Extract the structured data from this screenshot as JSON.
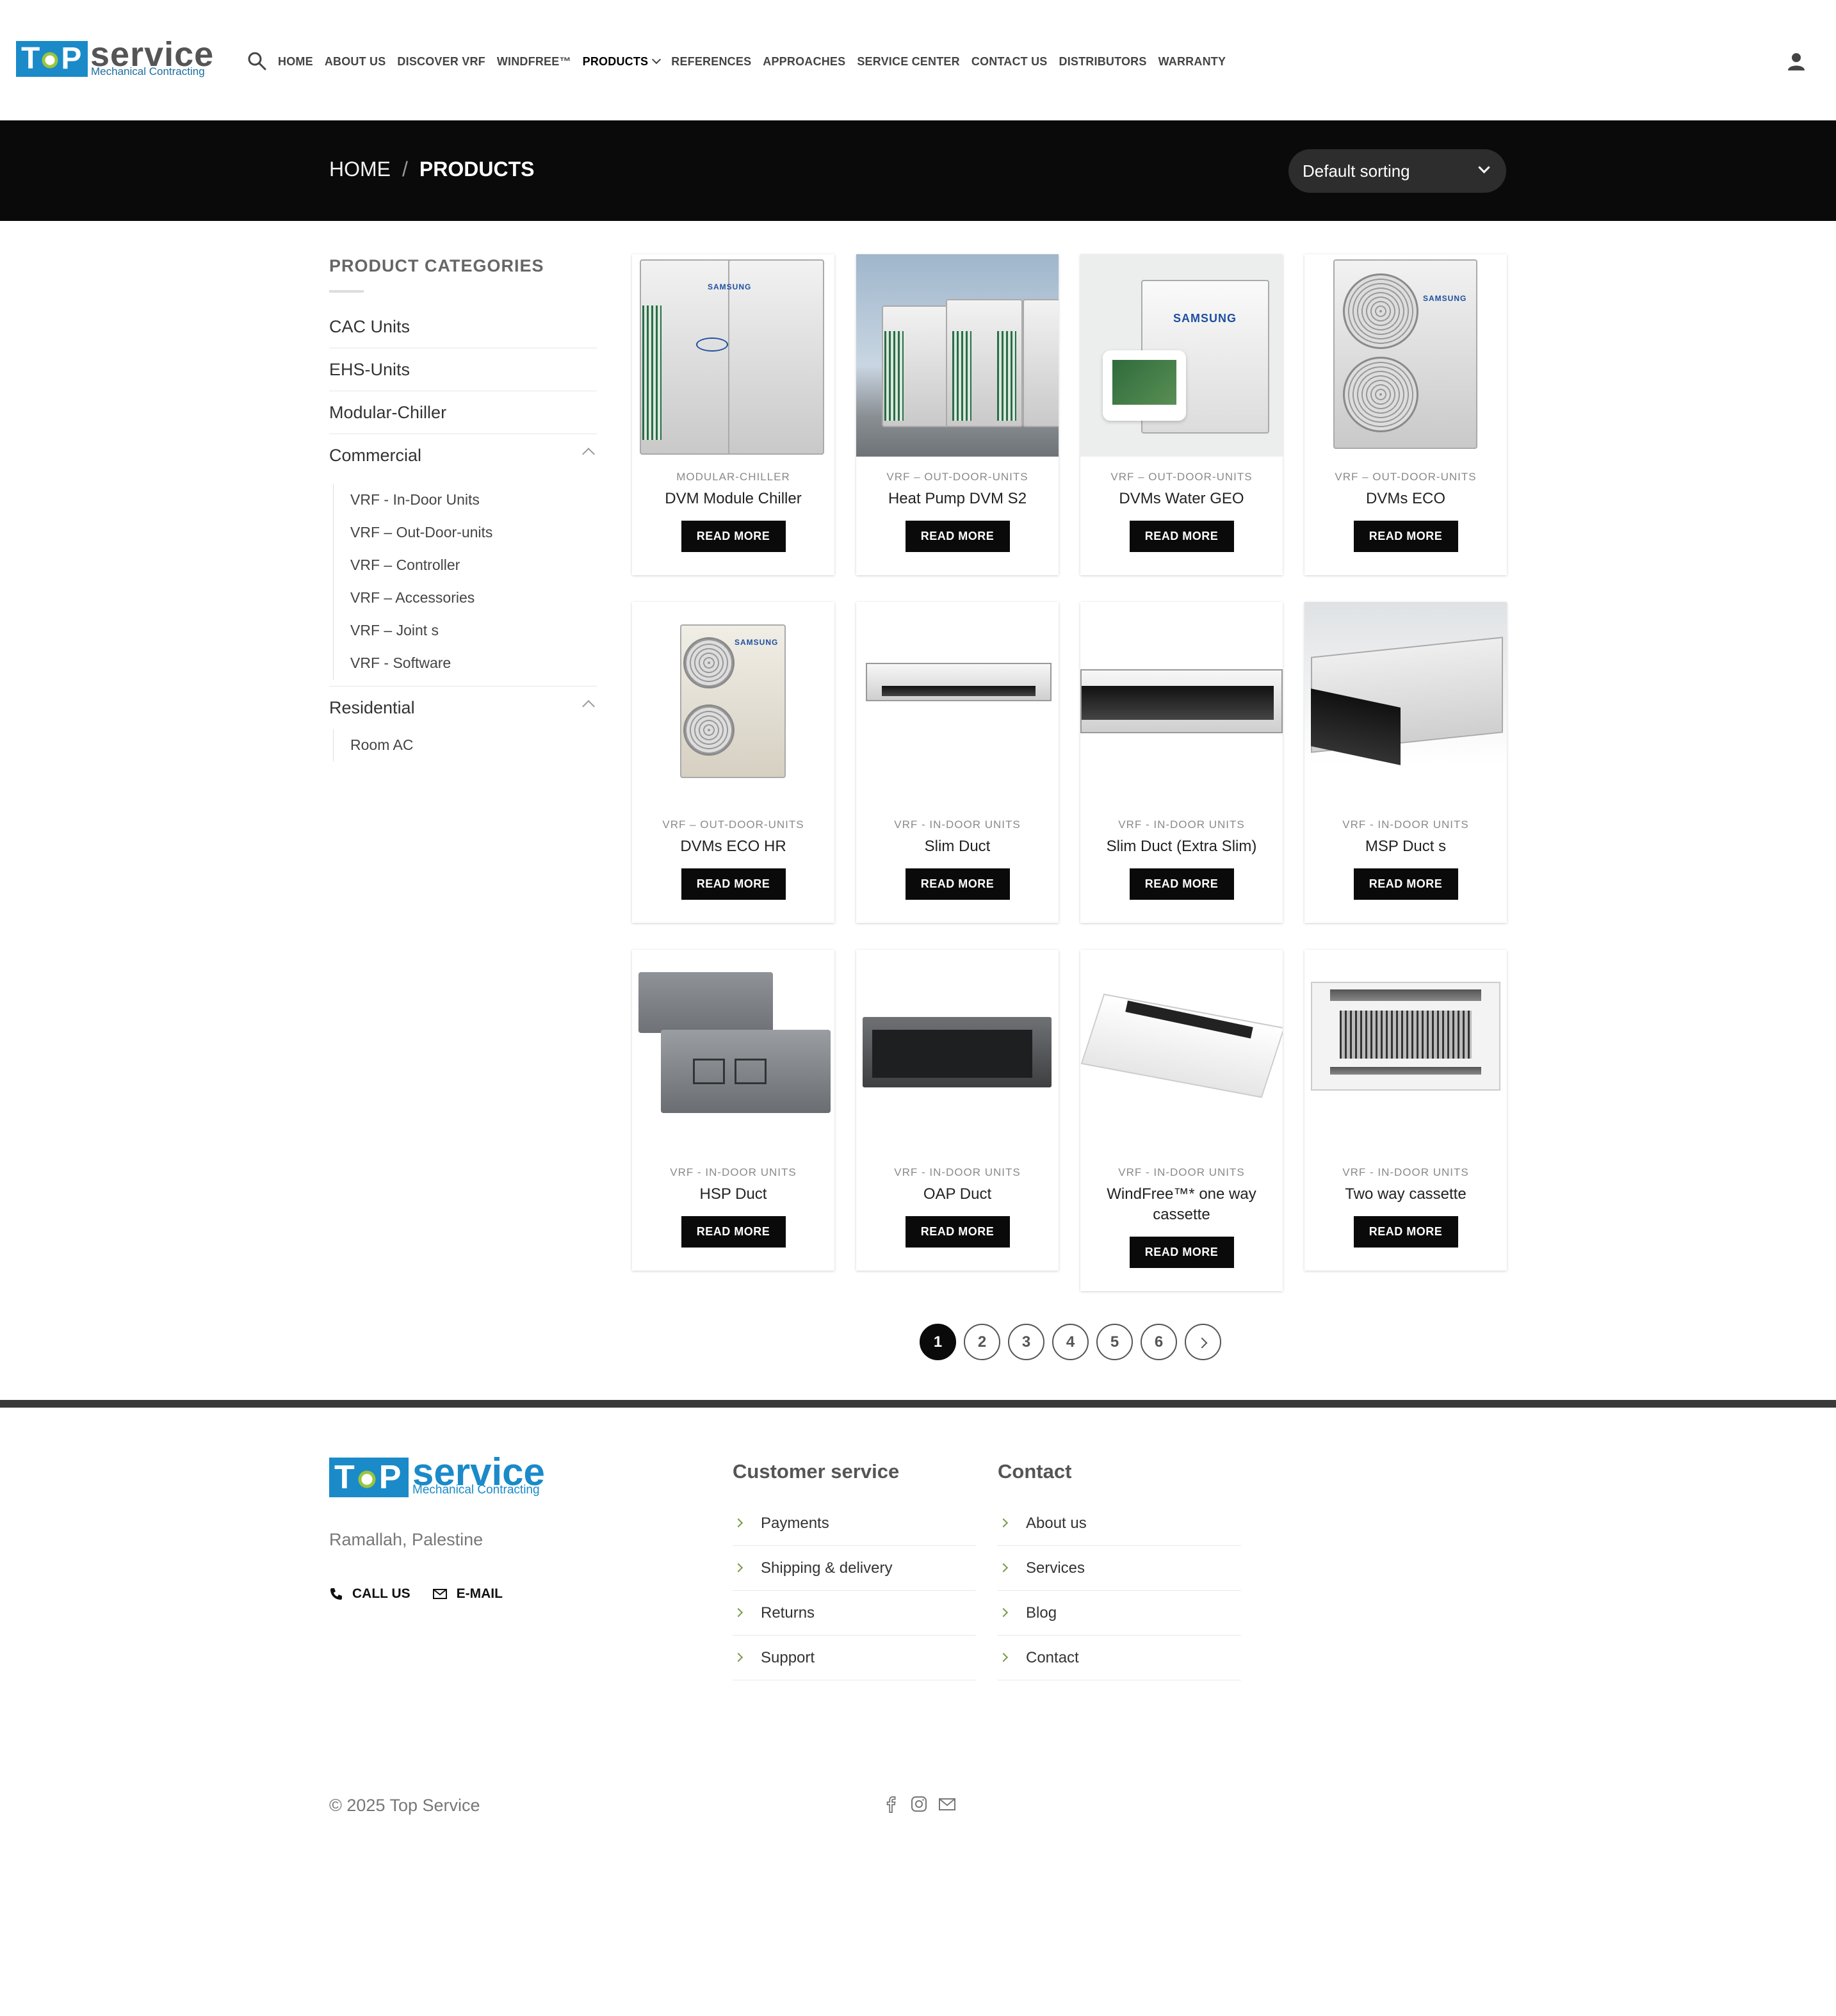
{
  "header": {
    "logo": {
      "word_a": "T",
      "word_b": "P",
      "word_service": "service",
      "tagline": "Mechanical Contracting"
    },
    "nav": [
      {
        "label": "HOME",
        "active": false
      },
      {
        "label": "ABOUT US",
        "active": false
      },
      {
        "label": "DISCOVER VRF",
        "active": false
      },
      {
        "label": "WINDFREE™",
        "active": false
      },
      {
        "label": "PRODUCTS",
        "active": true,
        "has_dropdown": true
      },
      {
        "label": "REFERENCES",
        "active": false
      },
      {
        "label": "APPROACHES",
        "active": false
      },
      {
        "label": "SERVICE CENTER",
        "active": false
      },
      {
        "label": "CONTACT US",
        "active": false
      },
      {
        "label": "DISTRIBUTORS",
        "active": false
      },
      {
        "label": "WARRANTY",
        "active": false
      }
    ],
    "icons": {
      "search": "search-icon",
      "account": "user-icon"
    }
  },
  "titlebar": {
    "breadcrumb_home": "HOME",
    "breadcrumb_sep": "/",
    "breadcrumb_current": "PRODUCTS",
    "sort_selected": "Default sorting"
  },
  "sidebar": {
    "title": "PRODUCT CATEGORIES",
    "categories": [
      {
        "label": "CAC Units"
      },
      {
        "label": "EHS-Units"
      },
      {
        "label": "Modular-Chiller"
      },
      {
        "label": "Commercial",
        "expanded": true,
        "children": [
          "VRF - In-Door Units",
          "VRF – Out-Door-units",
          "VRF – Controller",
          "VRF – Accessories",
          "VRF – Joint s",
          "VRF - Software"
        ]
      },
      {
        "label": "Residential",
        "expanded": true,
        "children": [
          "Room AC"
        ]
      }
    ]
  },
  "products": [
    {
      "category": "MODULAR-CHILLER",
      "name": "DVM Module Chiller",
      "button": "READ MORE",
      "image": "outdoor-chiller"
    },
    {
      "category": "VRF – OUT-DOOR-UNITS",
      "name": "Heat Pump DVM S2",
      "button": "READ MORE",
      "image": "rooftop-units"
    },
    {
      "category": "VRF – OUT-DOOR-UNITS",
      "name": "DVMs Water GEO",
      "button": "READ MORE",
      "image": "water-unit"
    },
    {
      "category": "VRF – OUT-DOOR-UNITS",
      "name": "DVMs ECO",
      "button": "READ MORE",
      "image": "two-fan-unit"
    },
    {
      "category": "VRF – OUT-DOOR-UNITS",
      "name": "DVMs ECO HR",
      "button": "READ MORE",
      "image": "two-fan-unit-beige"
    },
    {
      "category": "VRF - IN-DOOR UNITS",
      "name": "Slim Duct",
      "button": "READ MORE",
      "image": "slim-duct"
    },
    {
      "category": "VRF - IN-DOOR UNITS",
      "name": "Slim Duct (Extra Slim)",
      "button": "READ MORE",
      "image": "extra-slim-duct"
    },
    {
      "category": "VRF - IN-DOOR UNITS",
      "name": "MSP Duct s",
      "button": "READ MORE",
      "image": "msp-duct"
    },
    {
      "category": "VRF - IN-DOOR UNITS",
      "name": "HSP Duct",
      "button": "READ MORE",
      "image": "hsp-duct"
    },
    {
      "category": "VRF - IN-DOOR UNITS",
      "name": "OAP Duct",
      "button": "READ MORE",
      "image": "oap-duct"
    },
    {
      "category": "VRF - IN-DOOR UNITS",
      "name": "WindFree™* one way cassette",
      "button": "READ MORE",
      "image": "one-way-cassette"
    },
    {
      "category": "VRF - IN-DOOR UNITS",
      "name": "Two way cassette",
      "button": "READ MORE",
      "image": "two-way-cassette"
    }
  ],
  "brand_text": "SAMSUNG",
  "pagination": {
    "pages": [
      "1",
      "2",
      "3",
      "4",
      "5",
      "6"
    ],
    "current": "1",
    "next_icon": "chevron-right-icon"
  },
  "footer": {
    "logo": {
      "word_a": "T",
      "word_b": "P",
      "word_service": "service",
      "tagline": "Mechanical Contracting"
    },
    "address": "Ramallah, Palestine",
    "call_label": "CALL US",
    "email_label": "E-MAIL",
    "customer_service": {
      "title": "Customer service",
      "links": [
        "Payments",
        "Shipping & delivery",
        "Returns",
        "Support"
      ]
    },
    "contact": {
      "title": "Contact",
      "links": [
        "About us",
        "Services",
        "Blog",
        "Contact"
      ]
    },
    "copyright": "© 2025 Top Service",
    "social_icons": [
      "facebook-icon",
      "instagram-icon",
      "email-icon"
    ]
  },
  "colors": {
    "brand_blue": "#1a8ac9",
    "brand_green": "#9bc53d",
    "titlebar_bg": "#0a0a0a",
    "button_bg": "#0a0a0a"
  }
}
